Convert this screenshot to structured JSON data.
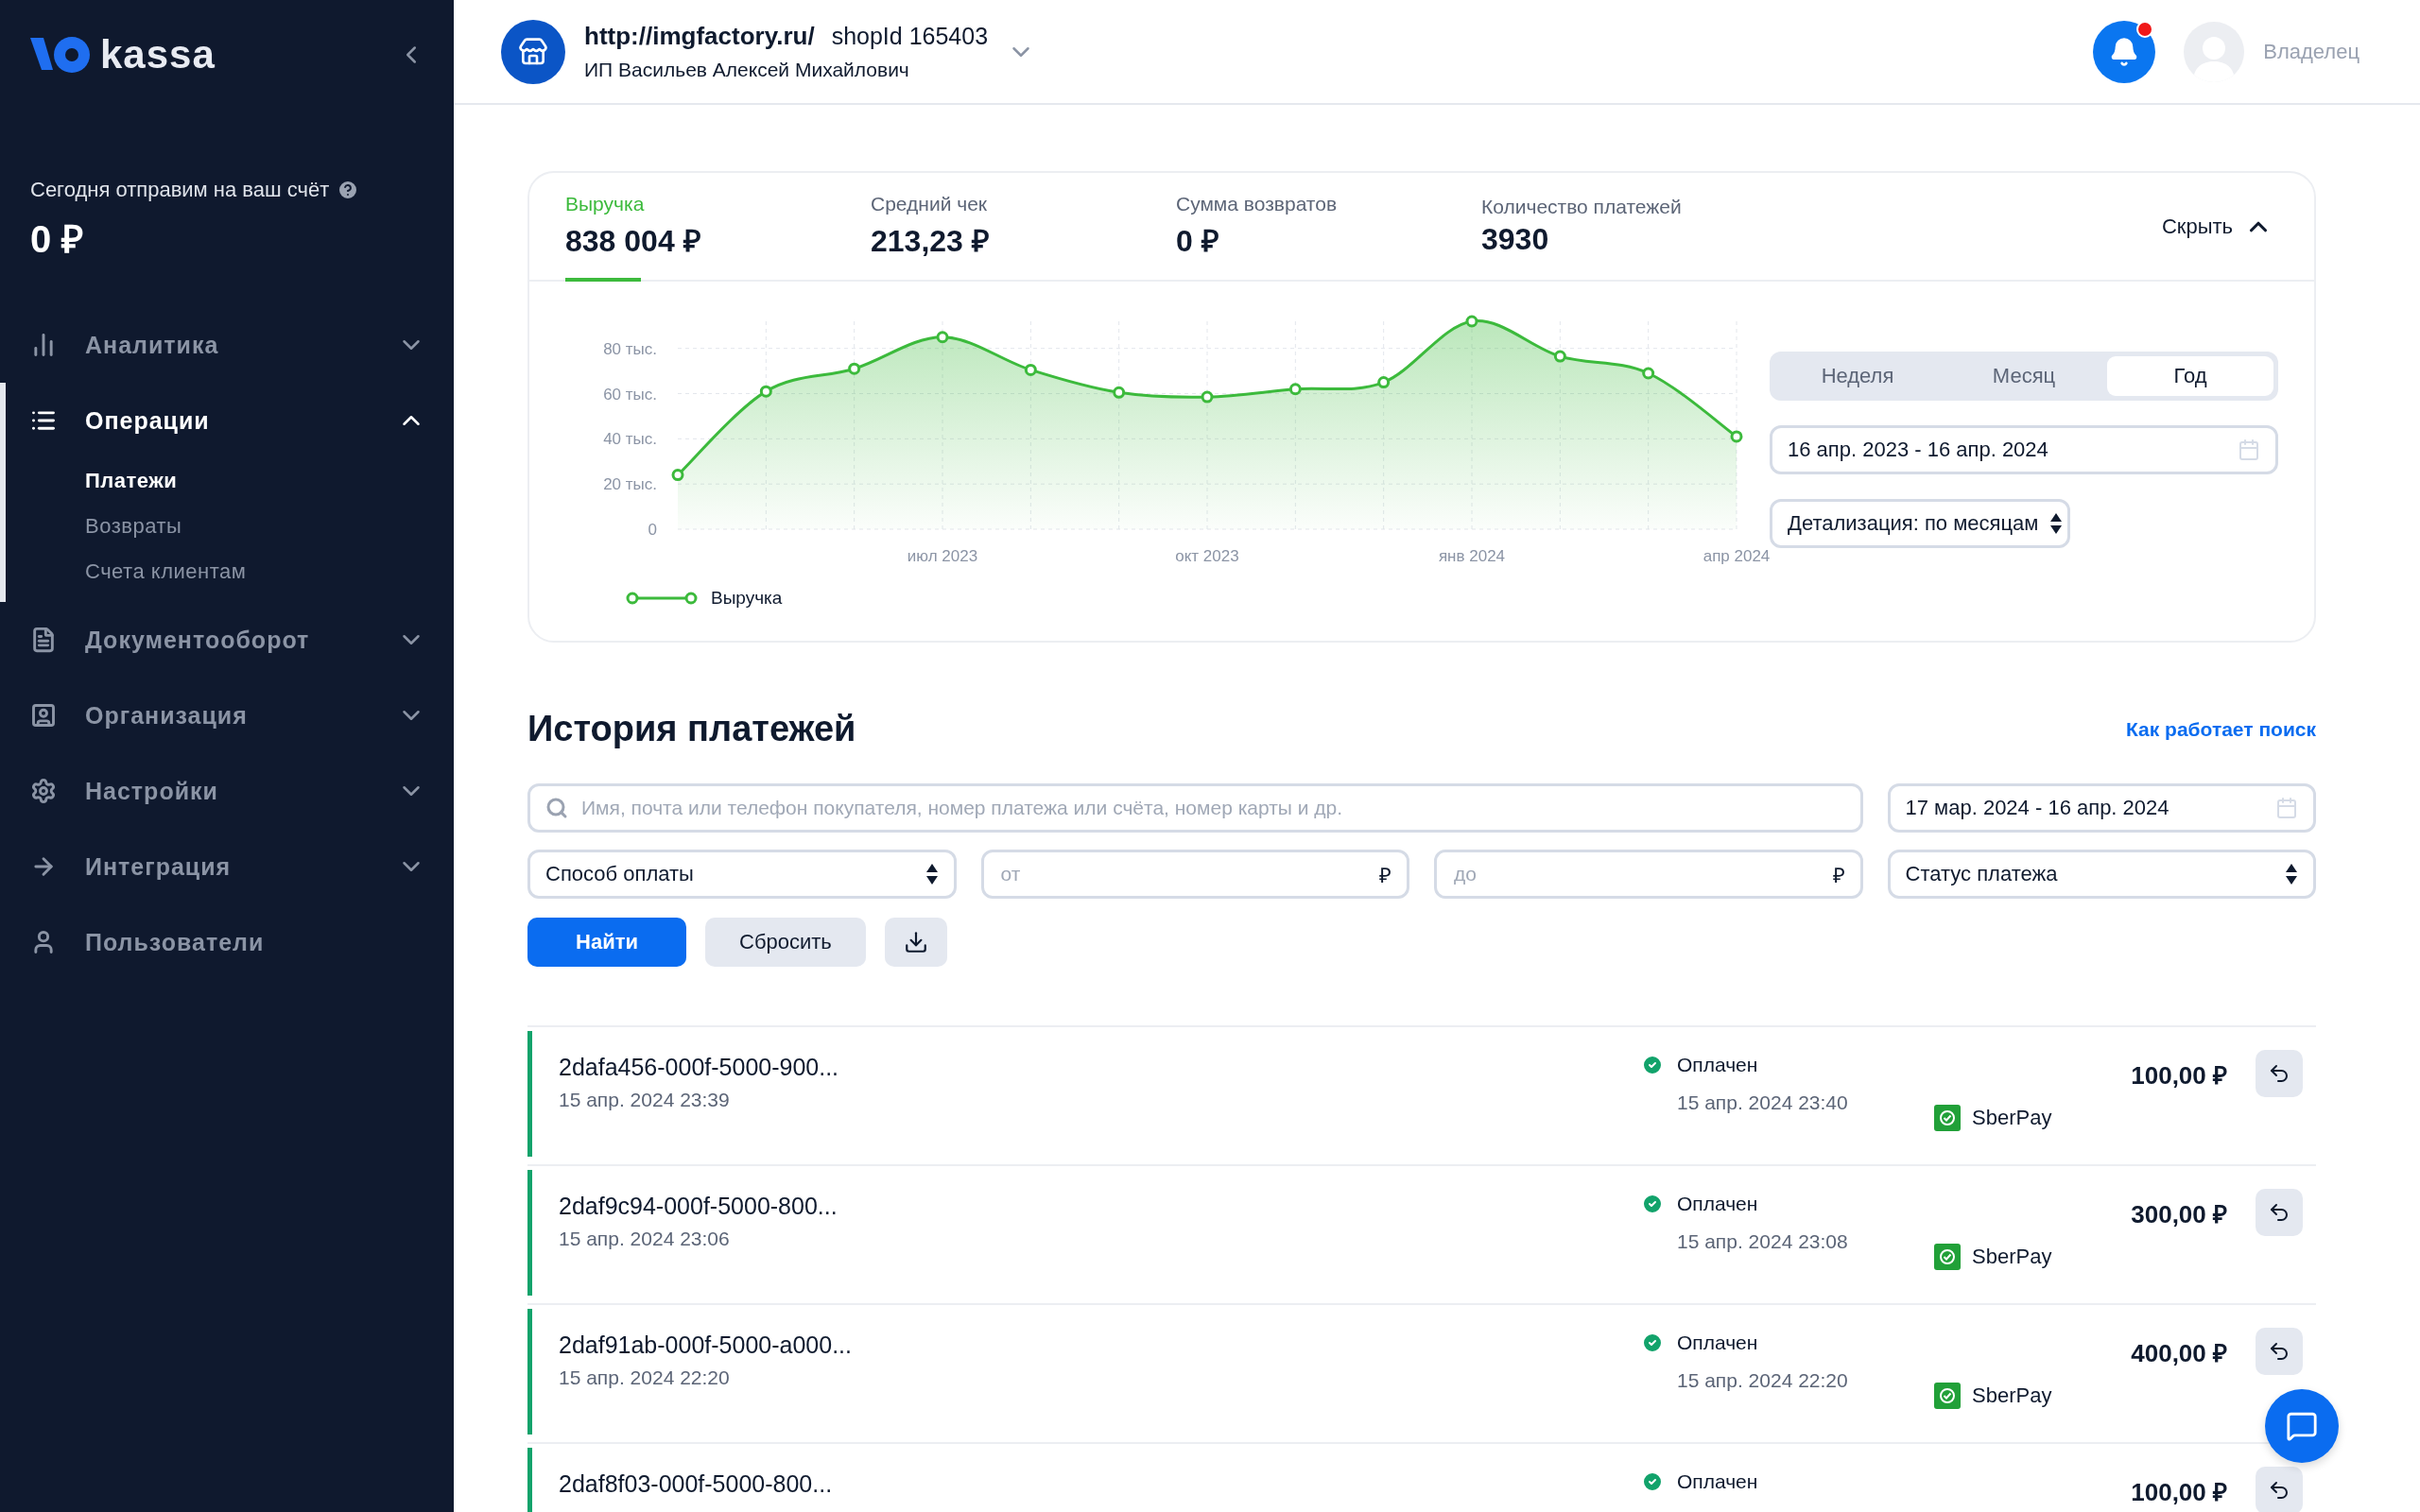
{
  "sidebar": {
    "logo_text": "kassa",
    "balance": {
      "label": "Сегодня отправим на ваш счёт",
      "amount": "0 ₽"
    },
    "nav": [
      {
        "label": "Аналитика",
        "selected": false,
        "expanded": false
      },
      {
        "label": "Операции",
        "selected": true,
        "expanded": true,
        "children": [
          {
            "label": "Платежи",
            "selected": true
          },
          {
            "label": "Возвраты",
            "selected": false
          },
          {
            "label": "Счета клиентам",
            "selected": false
          }
        ]
      },
      {
        "label": "Документооборот",
        "selected": false,
        "expanded": false
      },
      {
        "label": "Организация",
        "selected": false,
        "expanded": false
      },
      {
        "label": "Настройки",
        "selected": false,
        "expanded": false
      },
      {
        "label": "Интеграция",
        "selected": false,
        "expanded": false
      },
      {
        "label": "Пользователи",
        "selected": false
      }
    ]
  },
  "header": {
    "site": "http://imgfactory.ru/",
    "shop_id": "shopId 165403",
    "owner": "ИП Васильев Алексей Михайлович",
    "unread_notifications": true,
    "role": "Владелец"
  },
  "stats": {
    "tabs": [
      {
        "label": "Выручка",
        "value": "838 004 ₽",
        "selected": true
      },
      {
        "label": "Средний чек",
        "value": "213,23 ₽",
        "selected": false
      },
      {
        "label": "Сумма возвратов",
        "value": "0 ₽",
        "selected": false
      },
      {
        "label": "Количество платежей",
        "value": "3930",
        "selected": false
      }
    ],
    "hide_button": "Скрыть",
    "period_tabs": [
      {
        "label": "Неделя",
        "selected": false
      },
      {
        "label": "Месяц",
        "selected": false
      },
      {
        "label": "Год",
        "selected": true
      }
    ],
    "date_range": "16 апр. 2023 - 16 апр. 2024",
    "detail_select": "Детализация: по месяцам",
    "chart_data": {
      "type": "area",
      "grid": true,
      "categories": [
        null,
        null,
        null,
        "июл 2023",
        null,
        null,
        "окт 2023",
        null,
        null,
        "янв 2024",
        null,
        null,
        "апр 2024"
      ],
      "ylim": [
        0,
        92
      ],
      "yticks": [
        {
          "value": 0,
          "label": "0"
        },
        {
          "value": 20,
          "label": "20 тыс."
        },
        {
          "value": 40,
          "label": "40 тыс."
        },
        {
          "value": 60,
          "label": "60 тыс."
        },
        {
          "value": 80,
          "label": "80 тыс."
        }
      ],
      "series": [
        {
          "name": "Выручка",
          "color": "#3cba3c",
          "values": [
            24,
            61,
            71,
            85,
            70.5,
            60.5,
            58.5,
            62,
            65,
            92,
            76.5,
            69,
            41
          ]
        }
      ]
    }
  },
  "history": {
    "title": "История платежей",
    "help_link": "Как работает поиск",
    "search": {
      "placeholder": "Имя, почта или телефон покупателя, номер платежа или счёта, номер карты и др."
    },
    "date_range": "17 мар. 2024 - 16 апр. 2024",
    "method_select": "Способ оплаты",
    "amount_from": {
      "placeholder": "от",
      "currency": "₽"
    },
    "amount_to": {
      "placeholder": "до",
      "currency": "₽"
    },
    "status_select": "Статус платежа",
    "find_button": "Найти",
    "reset_button": "Сбросить",
    "payments": [
      {
        "id": "2dafa456-000f-5000-900...",
        "created": "15 апр. 2024 23:39",
        "status": "Оплачен",
        "paid_at": "15 апр. 2024 23:40",
        "method": "SberPay",
        "amount": "100,00 ₽"
      },
      {
        "id": "2daf9c94-000f-5000-800...",
        "created": "15 апр. 2024 23:06",
        "status": "Оплачен",
        "paid_at": "15 апр. 2024 23:08",
        "method": "SberPay",
        "amount": "300,00 ₽"
      },
      {
        "id": "2daf91ab-000f-5000-a000...",
        "created": "15 апр. 2024 22:20",
        "status": "Оплачен",
        "paid_at": "15 апр. 2024 22:20",
        "method": "SberPay",
        "amount": "400,00 ₽"
      },
      {
        "id": "2daf8f03-000f-5000-800...",
        "status": "Оплачен",
        "amount": "100,00 ₽"
      }
    ]
  }
}
